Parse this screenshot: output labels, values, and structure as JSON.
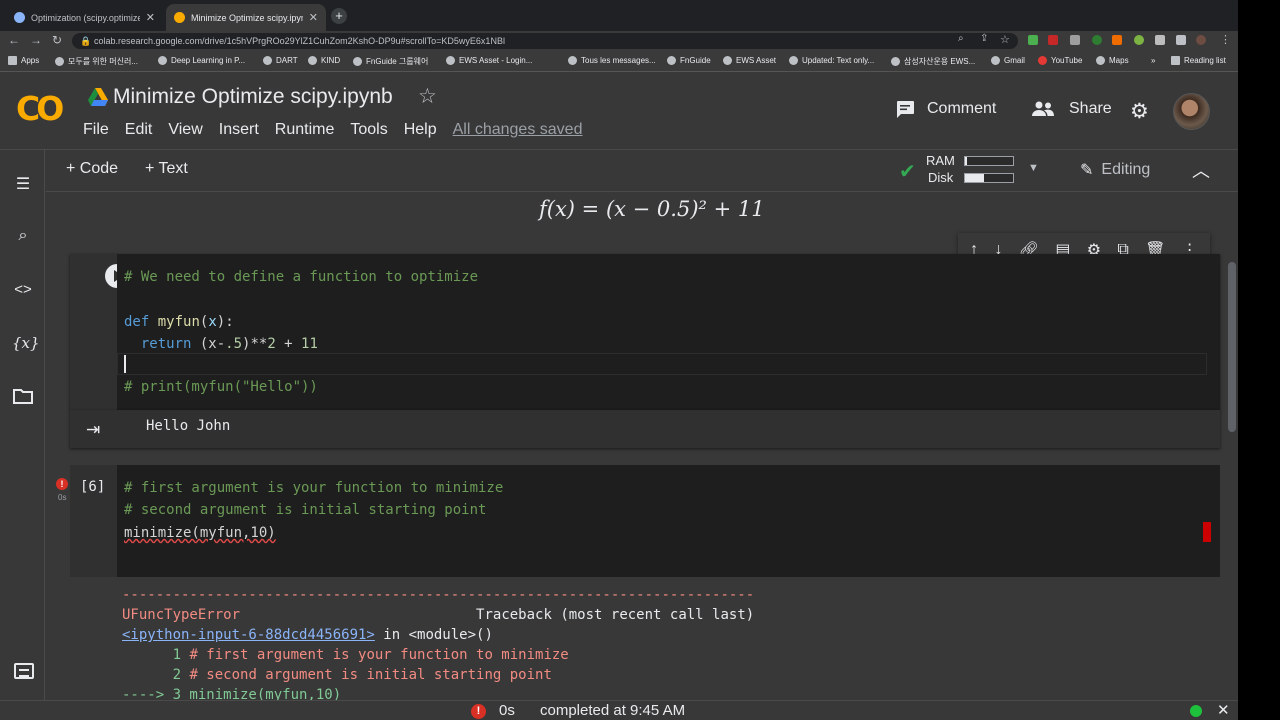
{
  "browser": {
    "tabs": [
      {
        "title": "Optimization (scipy.optimize) —",
        "active": false
      },
      {
        "title": "Minimize Optimize scipy.ipynb",
        "active": true
      }
    ],
    "url": "colab.research.google.com/drive/1c5hVPrgROo29YlZ1CuhZom2KshO-DP9u#scrollTo=KD5wyE6x1NBl",
    "bookmarks": [
      "Apps",
      "모두를 위한 머신러...",
      "Deep Learning in P...",
      "DART",
      "KIND",
      "FnGuide 그룹웨어",
      "EWS Asset - Login...",
      "Tous les messages...",
      "FnGuide",
      "EWS Asset",
      "Updated: Text only...",
      "삼성자산운용 EWS...",
      "Gmail",
      "YouTube",
      "Maps",
      "»",
      "Reading list"
    ]
  },
  "header": {
    "logo": "CO",
    "title": "Minimize Optimize scipy.ipynb",
    "menu": [
      "File",
      "Edit",
      "View",
      "Insert",
      "Runtime",
      "Tools",
      "Help"
    ],
    "save_status": "All changes saved",
    "comment_label": "Comment",
    "share_label": "Share"
  },
  "toolbar": {
    "add_code": "+ Code",
    "add_text": "+ Text",
    "ram_label": "RAM",
    "disk_label": "Disk",
    "ram_usage": 0.05,
    "disk_usage": 0.4,
    "editing_label": "Editing"
  },
  "notebook": {
    "formula": "f(x) = (x − 0.5)² + 11",
    "cell1": {
      "lines": [
        "# We need to define a function to optimize",
        "",
        "def myfun(x):",
        "  return (x-.5)**2 + 11",
        "",
        "# print(myfun(\"Hello\"))"
      ],
      "output": "Hello John"
    },
    "cell2": {
      "exec_count": "[6]",
      "exec_time": "0s",
      "lines": [
        "# first argument is your function to minimize",
        "# second argument is initial starting point",
        "minimize(myfun,10)"
      ]
    },
    "traceback": {
      "divider": "---------------------------------------------------------------------------",
      "error_name": "UFuncTypeError",
      "header_right": "Traceback (most recent call last)",
      "location_link": "<ipython-input-6-88dcd4456691>",
      "location_rest": " in <module>()",
      "line1_num": "      1 ",
      "line1": "# first argument is your function to minimize",
      "line2_num": "      2 ",
      "line2": "# second argument is initial starting point",
      "line3": "----> 3 minimize(myfun,10)"
    }
  },
  "status": {
    "time": "0s",
    "text": "completed at 9:45 AM"
  },
  "colors": {
    "accent_orange": "#f9ab00",
    "success_green": "#34a853",
    "error_red": "#d93025"
  }
}
